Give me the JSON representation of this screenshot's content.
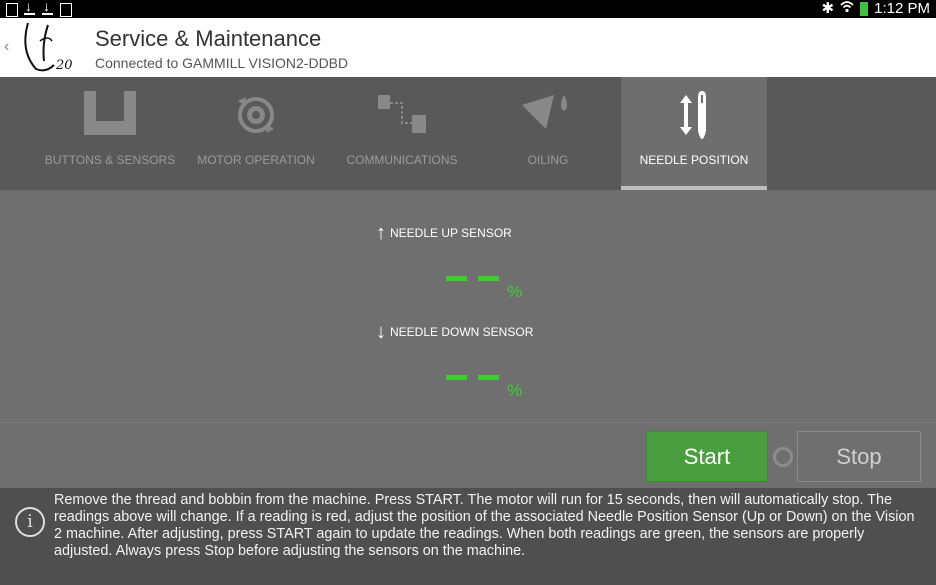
{
  "status_bar": {
    "time": "1:12 PM",
    "icons": [
      "image-icon",
      "download-icon",
      "download-icon",
      "screen-icon",
      "bluetooth-icon",
      "wifi-icon",
      "battery-icon"
    ]
  },
  "header": {
    "title": "Service & Maintenance",
    "subtitle": "Connected to GAMMILL VISION2-DDBD",
    "logo_text": "20"
  },
  "tabs": [
    {
      "label": "BUTTONS & SENSORS",
      "icon": "u-frame-icon"
    },
    {
      "label": "MOTOR OPERATION",
      "icon": "motor-gear-icon"
    },
    {
      "label": "COMMUNICATIONS",
      "icon": "communications-icon"
    },
    {
      "label": "OILING",
      "icon": "oil-can-icon"
    },
    {
      "label": "NEEDLE POSITION",
      "icon": "needle-position-icon",
      "active": true
    }
  ],
  "sensors": {
    "up_label": "NEEDLE UP SENSOR",
    "up_reading": "- -",
    "down_label": "NEEDLE DOWN SENSOR",
    "down_reading": "- -",
    "unit": "%",
    "reading_color": "#3ecf2f"
  },
  "controls": {
    "start_label": "Start",
    "stop_label": "Stop"
  },
  "info": {
    "text": "Remove the thread and bobbin from the machine. Press START. The motor will run for 15 seconds, then will automatically stop. The readings above will change. If a reading is red, adjust the position of the associated Needle Position Sensor (Up or Down) on the Vision 2 machine. After adjusting, press START again to update the readings. When both readings are green, the sensors are properly adjusted. Always press Stop before adjusting the sensors on the machine."
  }
}
